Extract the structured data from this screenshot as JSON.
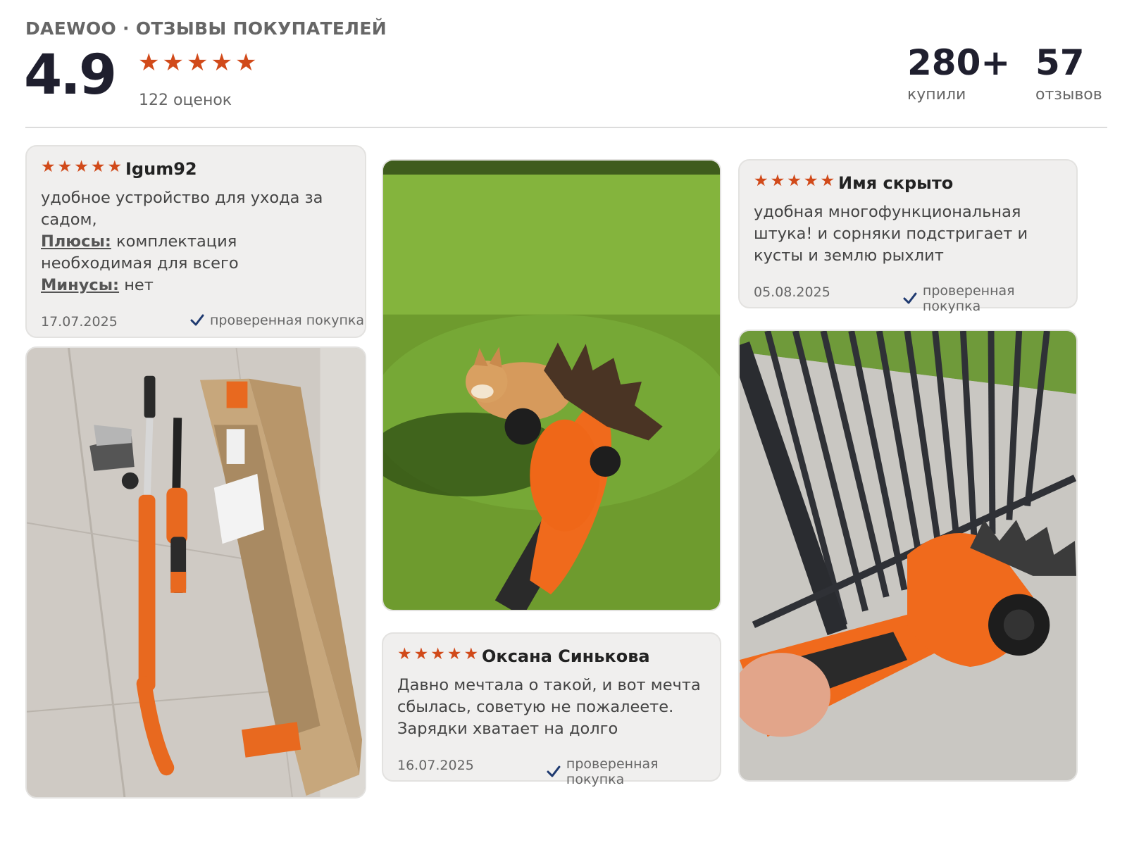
{
  "header": {
    "brand_line": "DAEWOO · ОТЗЫВЫ ПОКУПАТЕЛЕЙ",
    "rating": "4.9",
    "ratings_count": "122 оценок",
    "bought_value": "280+",
    "bought_label": "купили",
    "reviews_value": "57",
    "reviews_label": "отзывов"
  },
  "star_char": "★",
  "colors": {
    "star": "#d14a1a",
    "card_bg": "#f0efee",
    "check": "#1f3a70"
  },
  "reviews": [
    {
      "author": "Igum92",
      "text": "удобное устройство для ухода за садом,",
      "pros_label": "Плюсы:",
      "pros": "комплектация необходимая для всего",
      "cons_label": "Минусы:",
      "cons": "нет",
      "date": "17.07.2025",
      "verified": "проверенная покупка"
    },
    {
      "author": "Имя скрыто",
      "text": "удобная многофункциональная штука! и сорняки подстригает и кусты и землю рыхлит",
      "date": "05.08.2025",
      "verified": "проверенная покупка"
    },
    {
      "author": "Оксана Синькова",
      "text": "Давно мечтала о такой, и вот мечта сбылась, советую не пожалеете. Зарядки хватает на долго",
      "date": "16.07.2025",
      "verified": "проверенная покупка"
    }
  ]
}
